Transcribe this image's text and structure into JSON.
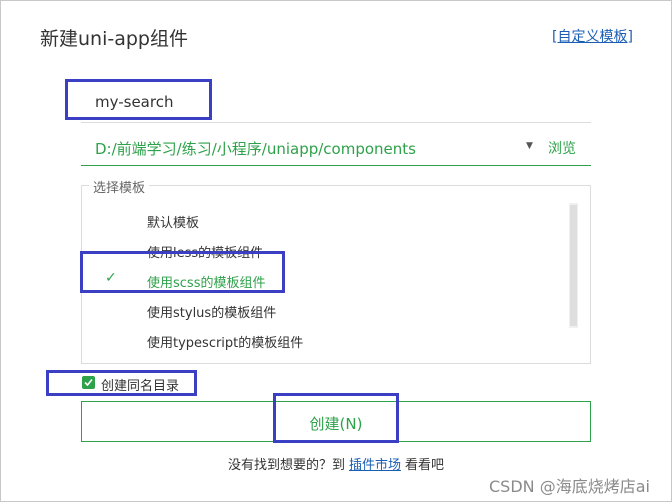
{
  "dialog": {
    "title": "新建uni-app组件",
    "custom_template_bracket_open": "[",
    "custom_template_link": "自定义模板",
    "custom_template_bracket_close": "]"
  },
  "name_field": {
    "value": "my-search"
  },
  "path_field": {
    "value": "D:/前端学习/练习/小程序/uniapp/components",
    "dropdown_icon": "triangle-down-icon",
    "browse_label": "浏览"
  },
  "template_group": {
    "legend": "选择模板",
    "items": [
      {
        "label": "默认模板",
        "selected": false
      },
      {
        "label": "使用less的模板组件",
        "selected": false
      },
      {
        "label": "使用scss的模板组件",
        "selected": true,
        "check": "✓"
      },
      {
        "label": "使用stylus的模板组件",
        "selected": false
      },
      {
        "label": "使用typescript的模板组件",
        "selected": false
      }
    ]
  },
  "same_dir": {
    "label": "创建同名目录",
    "checked": true
  },
  "create_button": {
    "label": "创建(N)"
  },
  "footer": {
    "prefix": "没有找到想要的？到",
    "link": "插件市场",
    "suffix": "看看吧"
  },
  "watermark": "CSDN @海底烧烤店ai",
  "colors": {
    "accent": "#2ea24a",
    "link": "#1a5fb4",
    "highlight": "#3a3fc4"
  }
}
